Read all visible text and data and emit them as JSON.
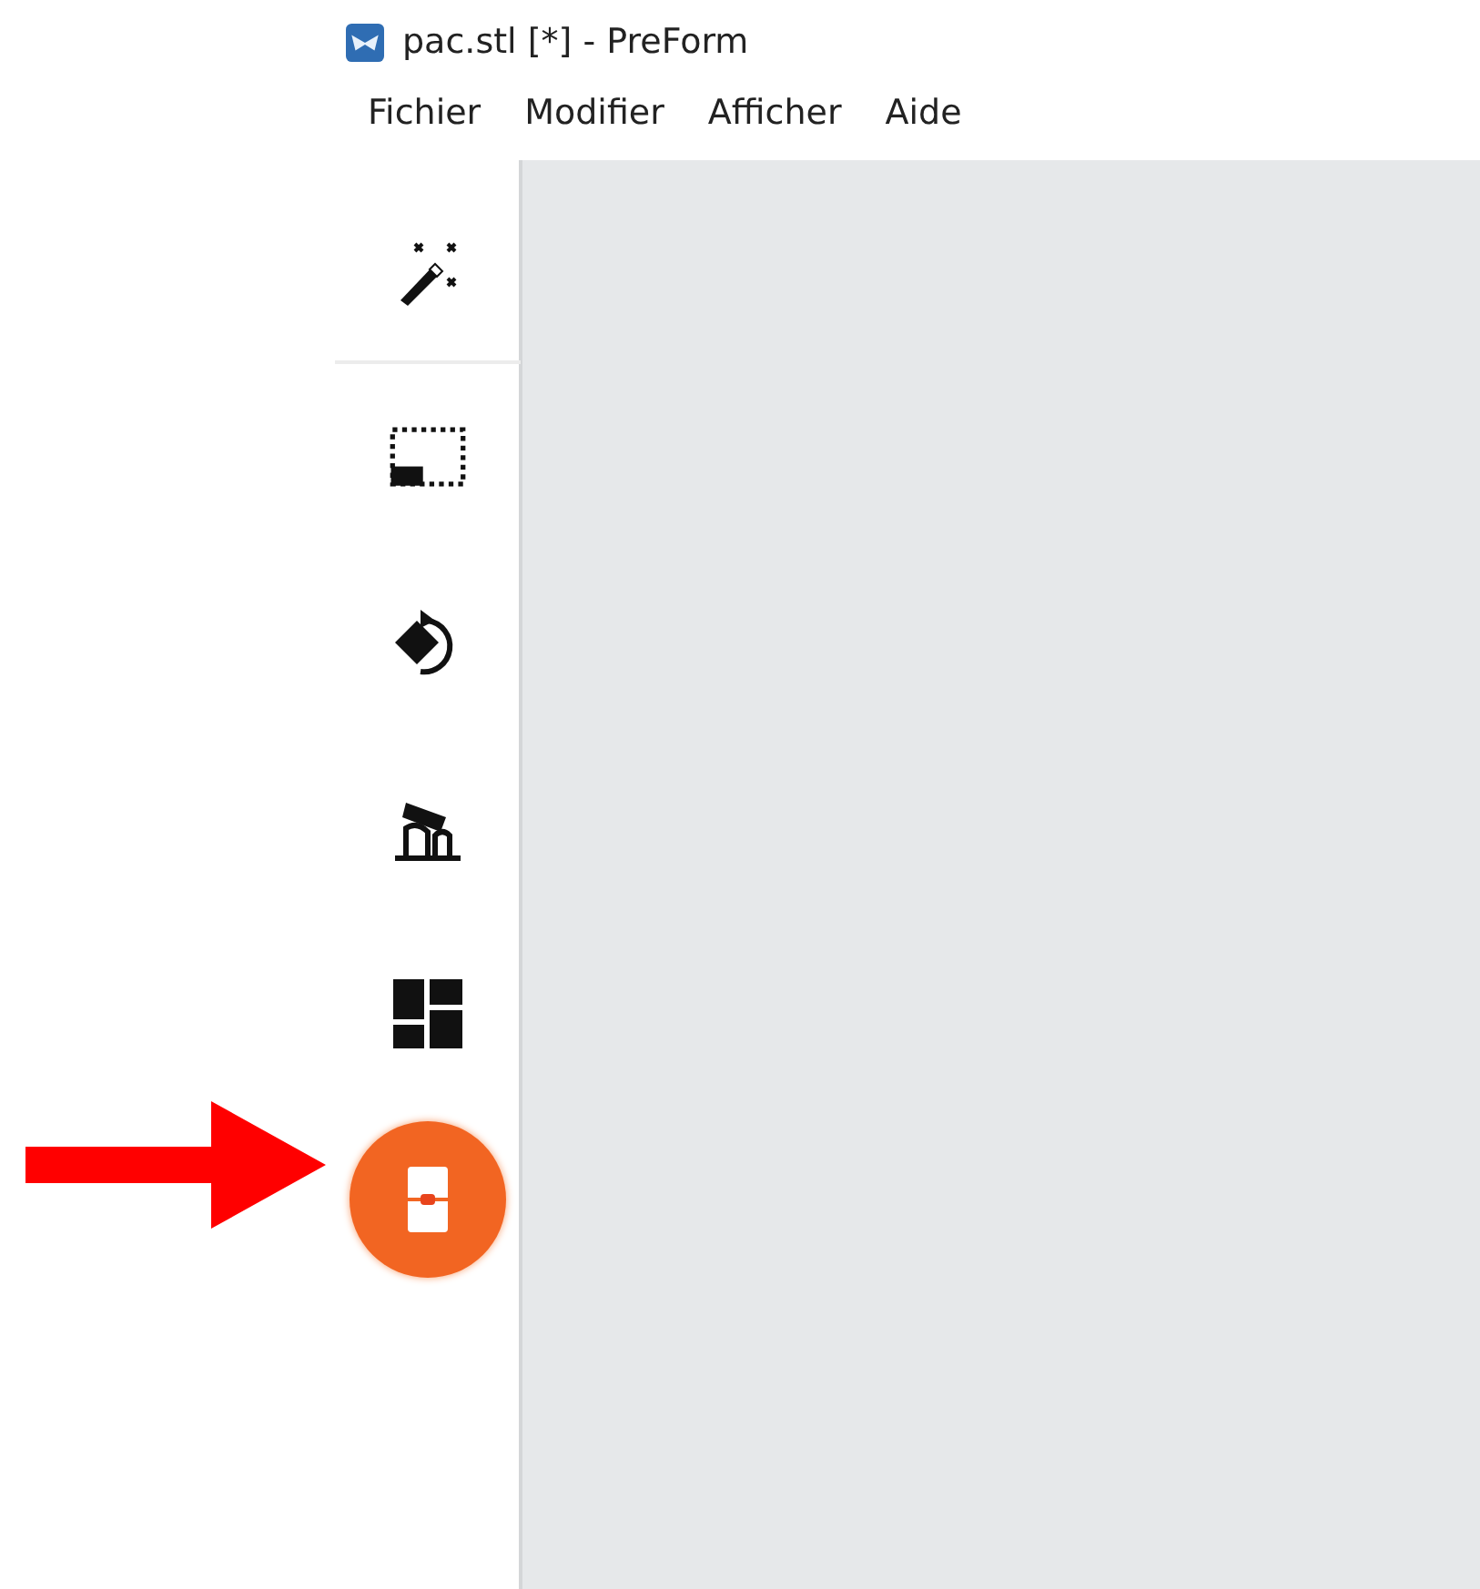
{
  "window": {
    "title": "pac.stl [*] - PreForm"
  },
  "menu": [
    "Fichier",
    "Modifier",
    "Afficher",
    "Aide"
  ],
  "tools": [
    {
      "kind": "wand",
      "selected": false
    },
    {
      "kind": "select",
      "selected": false
    },
    {
      "kind": "orient",
      "selected": false
    },
    {
      "kind": "supports",
      "selected": false
    },
    {
      "kind": "layout",
      "selected": false
    },
    {
      "kind": "print",
      "selected": true
    }
  ],
  "annotation": {
    "kind": "arrow"
  }
}
